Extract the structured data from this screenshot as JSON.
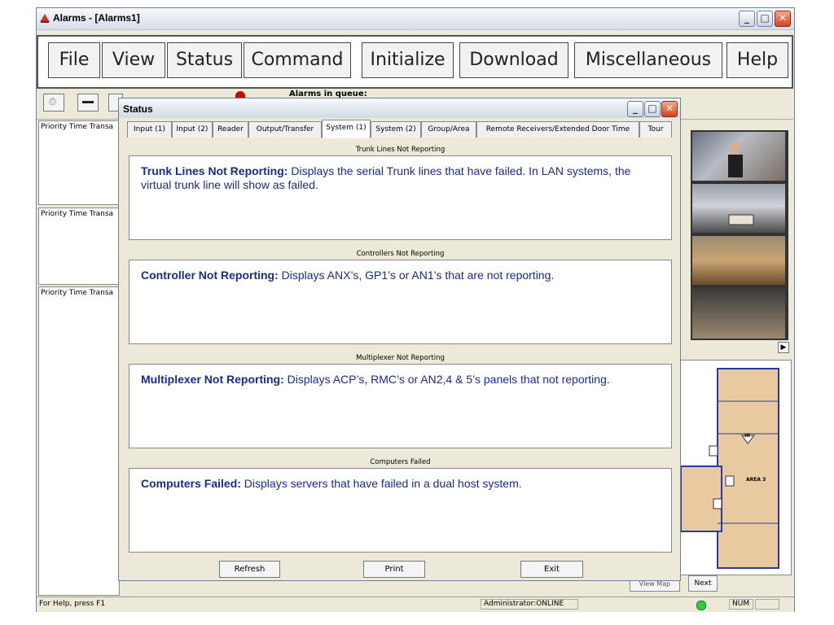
{
  "window": {
    "title": "Alarms - [Alarms1]"
  },
  "menu": [
    "File",
    "View",
    "Status",
    "Command",
    "Initialize",
    "Download",
    "Miscellaneous",
    "Help"
  ],
  "toolbar": {
    "queue_label": "Alarms in queue:"
  },
  "left_panes": [
    {
      "header": "Priority Time   Transa"
    },
    {
      "header": "Priority Time   Transa"
    },
    {
      "header": "Priority Time   Transa"
    }
  ],
  "map": {
    "area_label": "AREA 3",
    "ir_label": "IR"
  },
  "bottom_buttons": {
    "view_map": "View Map",
    "next": "Next"
  },
  "statusbar": {
    "help": "For Help, press F1",
    "user": "Administrator:ONLINE",
    "num": "NUM"
  },
  "dialog": {
    "title": "Status",
    "tabs": [
      "Input (1)",
      "Input (2)",
      "Reader",
      "Output/Transfer",
      "System (1)",
      "System (2)",
      "Group/Area",
      "Remote Receivers/Extended Door Time",
      "Tour"
    ],
    "active_tab": "System (1)",
    "sections": [
      {
        "header": "Trunk Lines Not Reporting",
        "term": "Trunk Lines Not Reporting:",
        "desc": " Displays the serial Trunk lines that have failed. In LAN systems, the virtual trunk line will show as failed."
      },
      {
        "header": "Controllers Not Reporting",
        "term": "Controller Not Reporting:",
        "desc": " Displays ANX’s, GP1’s or AN1’s that are not reporting."
      },
      {
        "header": "Multiplexer Not Reporting",
        "term": "Multiplexer Not Reporting:",
        "desc": " Displays ACP’s, RMC’s or AN2,4 & 5’s panels that not reporting."
      },
      {
        "header": "Computers Failed",
        "term": "Computers Failed:",
        "desc": " Displays servers that have failed in a dual host system."
      }
    ],
    "buttons": {
      "refresh": "Refresh",
      "print": "Print",
      "exit": "Exit"
    }
  },
  "colors": {
    "accent_text": "#1c2a8a",
    "close_button": "#d4421d",
    "map_fill": "#e8c9a0"
  }
}
